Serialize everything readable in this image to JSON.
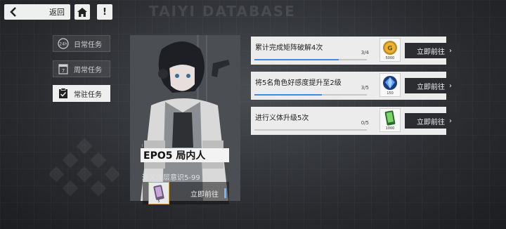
{
  "header": {
    "back_label": "返回",
    "bg_title": "TAIYI DATABASE"
  },
  "tabs": [
    {
      "label": "日常任务",
      "icon": "24h-icon"
    },
    {
      "label": "周常任务",
      "icon": "calendar-7-icon"
    },
    {
      "label": "常驻任务",
      "icon": "clipboard-check-icon",
      "active": true
    }
  ],
  "character": {
    "tag": "INSIDER",
    "name": "EPO5 局内人",
    "requirement": "通关浅层意识5-99",
    "reward_count": "5",
    "go_label": "立即前往"
  },
  "tasks": [
    {
      "title": "累计完成矩阵破解4次",
      "progress": "3/4",
      "progress_fraction": 0.75,
      "reward_count": "5000",
      "reward_icon": "gold-coin-icon",
      "go_label": "立即前往"
    },
    {
      "title": "将5名角色好感度提升至2级",
      "progress": "3/5",
      "progress_fraction": 0.6,
      "reward_count": "150",
      "reward_icon": "blue-crystal-icon",
      "go_label": "立即前往"
    },
    {
      "title": "进行义体升级5次",
      "progress": "0/5",
      "progress_fraction": 0,
      "reward_count": "1000",
      "reward_icon": "green-card-icon",
      "go_label": "立即前往"
    }
  ],
  "colors": {
    "accent_blue": "#3b8ee8",
    "button_dark": "#2c2d30",
    "panel_light": "#ececec"
  }
}
